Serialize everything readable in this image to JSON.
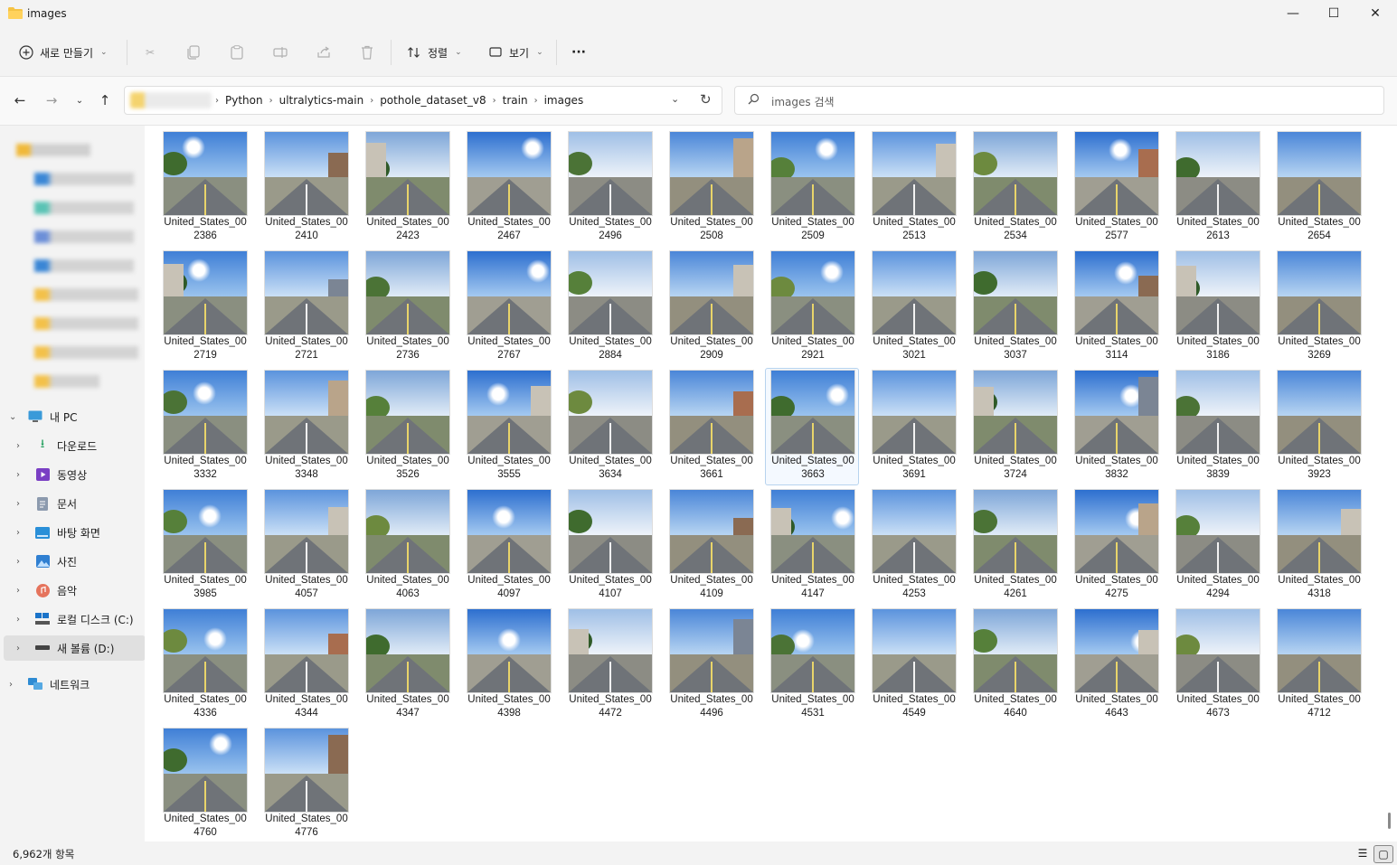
{
  "window": {
    "title": "images",
    "minimize": "—",
    "maximize": "☐",
    "close": "✕"
  },
  "toolbar": {
    "new_label": "새로 만들기",
    "sort_label": "정렬",
    "view_label": "보기",
    "more_label": "···"
  },
  "address": {
    "crumbs": [
      "Python",
      "ultralytics-main",
      "pothole_dataset_v8",
      "train",
      "images"
    ]
  },
  "search": {
    "placeholder": "images 검색"
  },
  "sidebar": {
    "this_pc": "내 PC",
    "items": [
      {
        "label": "다운로드",
        "icon": "download-icon"
      },
      {
        "label": "동영상",
        "icon": "video-icon"
      },
      {
        "label": "문서",
        "icon": "document-icon"
      },
      {
        "label": "바탕 화면",
        "icon": "desktop-icon"
      },
      {
        "label": "사진",
        "icon": "picture-icon"
      },
      {
        "label": "음악",
        "icon": "music-icon"
      },
      {
        "label": "로컬 디스크 (C:)",
        "icon": "drive-icon"
      },
      {
        "label": "새 볼륨 (D:)",
        "icon": "drive-icon"
      }
    ],
    "network": "네트워크"
  },
  "files": {
    "prefix": "United_States_00",
    "numbers": [
      "2386",
      "2410",
      "2423",
      "2467",
      "2496",
      "2508",
      "2509",
      "2513",
      "2534",
      "2577",
      "2613",
      "2654",
      "2719",
      "2721",
      "2736",
      "2767",
      "2884",
      "2909",
      "2921",
      "3021",
      "3037",
      "3114",
      "3186",
      "3269",
      "3332",
      "3348",
      "3526",
      "3555",
      "3634",
      "3661",
      "3663",
      "3691",
      "3724",
      "3832",
      "3839",
      "3923",
      "3985",
      "4057",
      "4063",
      "4097",
      "4107",
      "4109",
      "4147",
      "4253",
      "4261",
      "4275",
      "4294",
      "4318",
      "4336",
      "4344",
      "4347",
      "4398",
      "4472",
      "4496",
      "4531",
      "4549",
      "4640",
      "4643",
      "4673",
      "4712",
      "4760",
      "4776"
    ],
    "selected_index": 30
  },
  "status": {
    "count": "6,962개 항목"
  }
}
